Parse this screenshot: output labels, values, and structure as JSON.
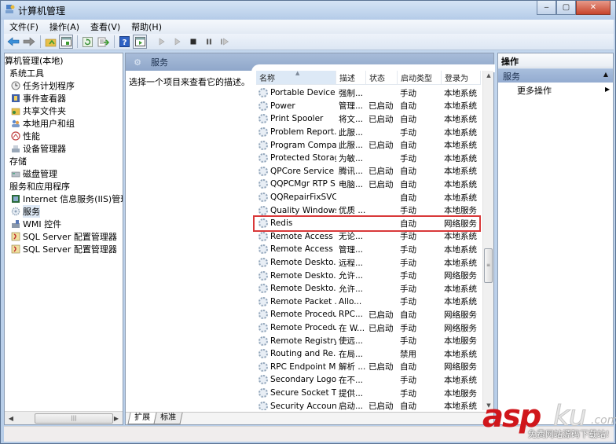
{
  "window": {
    "title": "计算机管理",
    "controls": {
      "minimize": "‒",
      "maximize": "▢",
      "close": "✕"
    }
  },
  "menu": [
    "文件(F)",
    "操作(A)",
    "查看(V)",
    "帮助(H)"
  ],
  "toolbar": {
    "buttons": [
      {
        "name": "back",
        "icon": "back-arrow-icon"
      },
      {
        "name": "forward",
        "icon": "forward-arrow-icon"
      },
      {
        "name": "up",
        "icon": "up-folder-icon"
      },
      {
        "name": "show-hide-console-tree",
        "icon": "console-tree-icon"
      },
      {
        "name": "refresh",
        "icon": "refresh-icon"
      },
      {
        "name": "export-list",
        "icon": "export-list-icon"
      },
      {
        "name": "help",
        "icon": "help-icon"
      },
      {
        "name": "show-hide-action-pane",
        "icon": "action-pane-icon"
      },
      {
        "name": "start-service",
        "icon": "play-icon"
      },
      {
        "name": "start-service-alt",
        "icon": "play-icon"
      },
      {
        "name": "stop-service",
        "icon": "stop-icon"
      },
      {
        "name": "pause-service",
        "icon": "pause-icon"
      },
      {
        "name": "restart-service",
        "icon": "restart-icon"
      }
    ]
  },
  "tree": {
    "items": [
      {
        "label": "算机管理(本地)",
        "level": 0,
        "icon": "computer-management-icon"
      },
      {
        "label": "系统工具",
        "level": 1,
        "icon": ""
      },
      {
        "label": "任务计划程序",
        "level": 2,
        "icon": "clock-icon"
      },
      {
        "label": "事件查看器",
        "level": 2,
        "icon": "event-viewer-icon"
      },
      {
        "label": "共享文件夹",
        "level": 2,
        "icon": "shared-folder-icon"
      },
      {
        "label": "本地用户和组",
        "level": 2,
        "icon": "users-icon"
      },
      {
        "label": "性能",
        "level": 2,
        "icon": "performance-icon"
      },
      {
        "label": "设备管理器",
        "level": 2,
        "icon": "device-manager-icon"
      },
      {
        "label": "存储",
        "level": 1,
        "icon": ""
      },
      {
        "label": "磁盘管理",
        "level": 2,
        "icon": "disk-icon"
      },
      {
        "label": "服务和应用程序",
        "level": 1,
        "icon": ""
      },
      {
        "label": "Internet 信息服务(IIS)管理器",
        "level": 2,
        "icon": "iis-icon"
      },
      {
        "label": "服务",
        "level": 2,
        "icon": "services-gear-icon",
        "selected": true
      },
      {
        "label": "WMI 控件",
        "level": 2,
        "icon": "wmi-icon"
      },
      {
        "label": "SQL Server 配置管理器",
        "level": 2,
        "icon": "sql-server-icon"
      },
      {
        "label": "SQL Server 配置管理器",
        "level": 2,
        "icon": "sql-server-icon"
      }
    ]
  },
  "center": {
    "header_title": "服务",
    "description": "选择一个项目来查看它的描述。",
    "columns": [
      "名称",
      "描述",
      "状态",
      "启动类型",
      "登录为"
    ],
    "rows": [
      {
        "name": "Portable Device ...",
        "desc": "强制...",
        "status": "",
        "startup": "手动",
        "logon": "本地系统"
      },
      {
        "name": "Power",
        "desc": "管理...",
        "status": "已启动",
        "startup": "自动",
        "logon": "本地系统"
      },
      {
        "name": "Print Spooler",
        "desc": "将文...",
        "status": "已启动",
        "startup": "自动",
        "logon": "本地系统"
      },
      {
        "name": "Problem Report...",
        "desc": "此服...",
        "status": "",
        "startup": "手动",
        "logon": "本地系统"
      },
      {
        "name": "Program Compa...",
        "desc": "此服...",
        "status": "已启动",
        "startup": "自动",
        "logon": "本地系统"
      },
      {
        "name": "Protected Storage",
        "desc": "为敏...",
        "status": "",
        "startup": "手动",
        "logon": "本地系统"
      },
      {
        "name": "QPCore Service",
        "desc": "腾讯...",
        "status": "已启动",
        "startup": "自动",
        "logon": "本地系统"
      },
      {
        "name": "QQPCMgr RTP S...",
        "desc": "电脑...",
        "status": "已启动",
        "startup": "自动",
        "logon": "本地系统"
      },
      {
        "name": "QQRepairFixSVC",
        "desc": "",
        "status": "",
        "startup": "自动",
        "logon": "本地系统"
      },
      {
        "name": "Quality Windows...",
        "desc": "优质 ...",
        "status": "",
        "startup": "手动",
        "logon": "本地服务"
      },
      {
        "name": "Redis",
        "desc": "",
        "status": "",
        "startup": "自动",
        "logon": "网络服务",
        "highlighted": true
      },
      {
        "name": "Remote Access ...",
        "desc": "无论...",
        "status": "",
        "startup": "手动",
        "logon": "本地系统"
      },
      {
        "name": "Remote Access ...",
        "desc": "管理...",
        "status": "",
        "startup": "手动",
        "logon": "本地系统"
      },
      {
        "name": "Remote Deskto...",
        "desc": "远程...",
        "status": "",
        "startup": "手动",
        "logon": "本地系统"
      },
      {
        "name": "Remote Deskto...",
        "desc": "允许...",
        "status": "",
        "startup": "手动",
        "logon": "网络服务"
      },
      {
        "name": "Remote Deskto...",
        "desc": "允许...",
        "status": "",
        "startup": "手动",
        "logon": "本地系统"
      },
      {
        "name": "Remote Packet ...",
        "desc": "Allo...",
        "status": "",
        "startup": "手动",
        "logon": "本地系统"
      },
      {
        "name": "Remote Procedu...",
        "desc": "RPC...",
        "status": "已启动",
        "startup": "自动",
        "logon": "网络服务"
      },
      {
        "name": "Remote Procedu...",
        "desc": "在 W...",
        "status": "已启动",
        "startup": "手动",
        "logon": "网络服务"
      },
      {
        "name": "Remote Registry",
        "desc": "使远...",
        "status": "",
        "startup": "手动",
        "logon": "本地服务"
      },
      {
        "name": "Routing and Re...",
        "desc": "在局...",
        "status": "",
        "startup": "禁用",
        "logon": "本地系统"
      },
      {
        "name": "RPC Endpoint M...",
        "desc": "解析 ...",
        "status": "已启动",
        "startup": "自动",
        "logon": "网络服务"
      },
      {
        "name": "Secondary Logon",
        "desc": "在不...",
        "status": "",
        "startup": "手动",
        "logon": "本地系统"
      },
      {
        "name": "Secure Socket T...",
        "desc": "提供...",
        "status": "",
        "startup": "手动",
        "logon": "本地服务"
      },
      {
        "name": "Security Account...",
        "desc": "启动...",
        "status": "已启动",
        "startup": "自动",
        "logon": "本地系统"
      }
    ],
    "tabs": [
      "扩展",
      "标准"
    ],
    "active_tab": "扩展"
  },
  "actions": {
    "title": "操作",
    "group": "服务",
    "more": "更多操作"
  },
  "watermark": {
    "brand_red": "asp",
    "brand_grey": "ku",
    "suffix": ".com",
    "tagline": "免费网站源码下载站!"
  },
  "colors": {
    "highlight_border": "#d9393a",
    "pane_header": "#93abd0",
    "watermark_red": "#d0161b"
  }
}
